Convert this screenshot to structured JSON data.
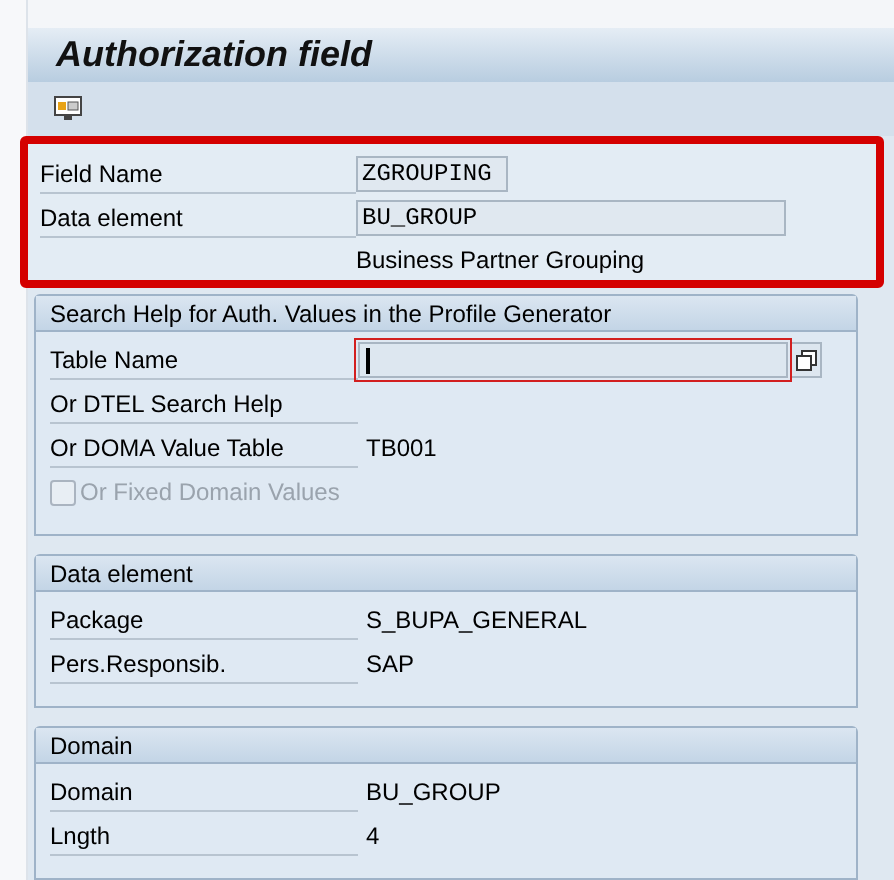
{
  "title": "Authorization field",
  "header_fields": [
    {
      "label": "Field Name",
      "value": "ZGROUPING",
      "kind": "short"
    },
    {
      "label": "Data element",
      "value": "BU_GROUP",
      "kind": "long"
    }
  ],
  "data_element_description": "Business Partner Grouping",
  "groups": [
    {
      "title": "Search Help for Auth. Values in the Profile Generator",
      "rows": [
        {
          "kind": "input",
          "label": "Table Name",
          "value": "",
          "focused": true
        },
        {
          "kind": "text",
          "label": "Or DTEL Search Help"
        },
        {
          "kind": "text",
          "label": "Or DOMA Value Table",
          "value": "TB001"
        },
        {
          "kind": "checkbox",
          "label": "Or Fixed Domain Values",
          "checked": false,
          "disabled": true
        }
      ]
    },
    {
      "title": "Data element",
      "rows": [
        {
          "kind": "text",
          "label": "Package",
          "value": "S_BUPA_GENERAL"
        },
        {
          "kind": "text",
          "label": "Pers.Responsib.",
          "value": "SAP"
        }
      ]
    },
    {
      "title": "Domain",
      "rows": [
        {
          "kind": "text",
          "label": "Domain",
          "value": "BU_GROUP"
        },
        {
          "kind": "text",
          "label": "Lngth",
          "value": "4"
        }
      ]
    }
  ]
}
